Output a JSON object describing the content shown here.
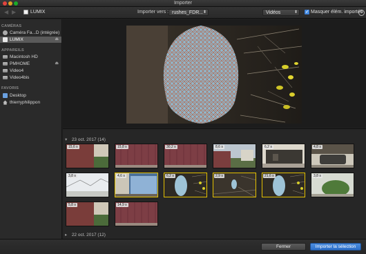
{
  "window": {
    "title": "Importer"
  },
  "toolbar": {
    "camera_label": "LUMIX",
    "import_to_label": "Importer vers :",
    "destination_value": "rushes_FDR...",
    "filter_value": "Vidéos",
    "hide_imported_label": "Masquer élém. importés",
    "hide_imported_checked": true
  },
  "sidebar": {
    "cameras_header": "CAMÉRAS",
    "cameras": [
      {
        "label": "Caméra Fa...D (intégrée)",
        "icon": "camera-icon"
      },
      {
        "label": "LUMIX",
        "icon": "sd-card-icon",
        "selected": true,
        "eject": "⏏"
      }
    ],
    "devices_header": "APPAREILS",
    "devices": [
      {
        "label": "Macintosh HD",
        "icon": "hard-drive-icon"
      },
      {
        "label": "PMHOME",
        "icon": "hard-drive-icon",
        "eject": "⏏"
      },
      {
        "label": "Video4",
        "icon": "hard-drive-icon"
      },
      {
        "label": "Video4bis",
        "icon": "hard-drive-icon"
      }
    ],
    "favorites_header": "FAVORIS",
    "favorites": [
      {
        "label": "Desktop",
        "icon": "desktop-icon"
      },
      {
        "label": "thierryphilippon",
        "icon": "home-icon"
      }
    ]
  },
  "browser": {
    "groups": [
      {
        "date": "23 oct. 2017",
        "count": "(14)"
      },
      {
        "date": "22 oct. 2017",
        "count": "(12)"
      }
    ],
    "clips": [
      {
        "duration": "15,6 s",
        "scene": "wall",
        "selected": false
      },
      {
        "duration": "15,8 s",
        "scene": "red-door",
        "selected": false
      },
      {
        "duration": "30,2 s",
        "scene": "red-door",
        "selected": false
      },
      {
        "duration": "8,6 s",
        "scene": "garden",
        "selected": false
      },
      {
        "duration": "6,2 s",
        "scene": "carport",
        "selected": false
      },
      {
        "duration": "4,8 s",
        "scene": "car",
        "selected": false
      },
      {
        "duration": "3,8 s",
        "scene": "sky",
        "selected": false
      },
      {
        "duration": "4,6 s",
        "scene": "window",
        "selected": true
      },
      {
        "duration": "6,2 s",
        "scene": "lantern",
        "selected": true
      },
      {
        "duration": "2,9 s",
        "scene": "lantern-far",
        "selected": true
      },
      {
        "duration": "21,6 s",
        "scene": "lantern",
        "selected": true
      },
      {
        "duration": "3,8 s",
        "scene": "bush",
        "selected": false
      },
      {
        "duration": "5,8 s",
        "scene": "wall",
        "selected": false
      },
      {
        "duration": "14,9 s",
        "scene": "red-door",
        "selected": false
      }
    ]
  },
  "bottom": {
    "close_label": "Fermer",
    "import_label": "Importer la sélection"
  },
  "colors": {
    "selection_border": "#e5c100",
    "primary_button": "#2c6fc9"
  }
}
